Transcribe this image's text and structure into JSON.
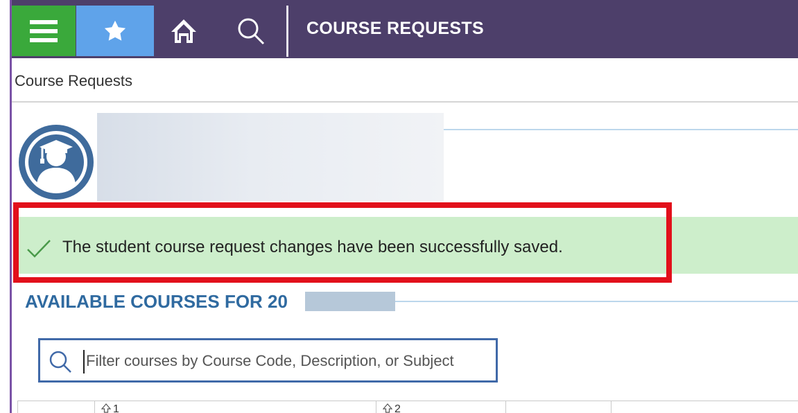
{
  "topbar": {
    "title": "COURSE REQUESTS",
    "buttons": [
      {
        "name": "menu",
        "icon": "hamburger-menu-icon",
        "color": "#3aa93b"
      },
      {
        "name": "favorites",
        "icon": "star-icon",
        "color": "#5fa3ea"
      },
      {
        "name": "home",
        "icon": "home-icon"
      },
      {
        "name": "search",
        "icon": "search-icon"
      }
    ],
    "background": "#4d3f6a"
  },
  "breadcrumb": "Course Requests",
  "student": {
    "avatar_icon": "graduate-avatar-icon",
    "avatar_color": "#3f6b9c"
  },
  "success": {
    "icon": "check-icon",
    "message": "The student course request changes have been successfully saved.",
    "background": "#cdeecb",
    "highlight_color": "#e2101b"
  },
  "courses": {
    "title": "AVAILABLE COURSES FOR 20",
    "title_color": "#2f6aa0"
  },
  "filter": {
    "icon": "search-icon",
    "placeholder": "Filter courses by Course Code, Description, or Subject"
  },
  "table": {
    "sort_headers": [
      "1",
      "2"
    ]
  }
}
